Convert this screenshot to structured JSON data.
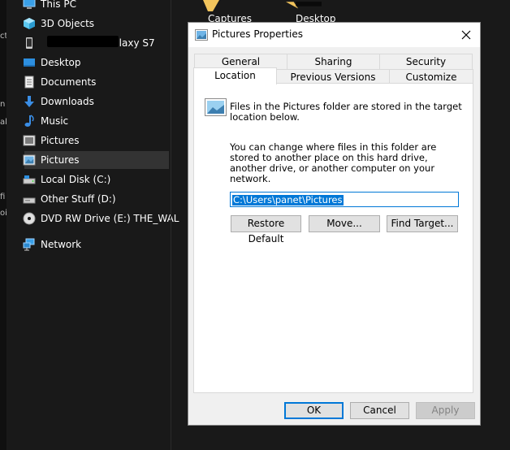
{
  "explorer": {
    "nav_items": [
      {
        "label": "This PC",
        "icon": "computer-icon"
      },
      {
        "label": "3D Objects",
        "icon": "cube-icon"
      },
      {
        "label": "Galaxy S7",
        "icon": "phone-icon"
      },
      {
        "label": "Desktop",
        "icon": "desktop-icon"
      },
      {
        "label": "Documents",
        "icon": "document-icon"
      },
      {
        "label": "Downloads",
        "icon": "download-arrow-icon"
      },
      {
        "label": "Music",
        "icon": "music-note-icon"
      },
      {
        "label": "Pictures",
        "icon": "pictures-icon"
      },
      {
        "label": "Pictures",
        "icon": "pictures-icon"
      },
      {
        "label": "Local Disk (C:)",
        "icon": "drive-icon"
      },
      {
        "label": "Other Stuff (D:)",
        "icon": "drive-icon"
      },
      {
        "label": "DVD RW Drive (E:) THE_WAL",
        "icon": "disc-icon"
      },
      {
        "label": "Network",
        "icon": "network-icon"
      }
    ],
    "folders": [
      {
        "label": "Captures",
        "icon": "folder-icon"
      },
      {
        "label": "Desktop",
        "icon": "folder-icon"
      }
    ],
    "edge_chars": [
      "ct",
      "n",
      "al",
      "fi",
      "oi"
    ]
  },
  "dialog": {
    "title": "Pictures Properties",
    "tabs_row1": [
      "General",
      "Sharing",
      "Security"
    ],
    "tabs_row2": [
      "Location",
      "Previous Versions",
      "Customize"
    ],
    "active_tab": "Location",
    "info_text": "Files in the Pictures folder are stored in the target location below.",
    "description": "You can change where files in this folder are stored to another place on this hard drive, another drive, or another computer on your network.",
    "path_value": "C:\\Users\\panet\\Pictures",
    "buttons": {
      "restore_default": "Restore Default",
      "move": "Move...",
      "find_target": "Find Target...",
      "ok": "OK",
      "cancel": "Cancel",
      "apply": "Apply"
    }
  },
  "colors": {
    "accent": "#0078d7",
    "explorer_bg": "#191919",
    "dialog_bg": "#f0f0f0"
  }
}
